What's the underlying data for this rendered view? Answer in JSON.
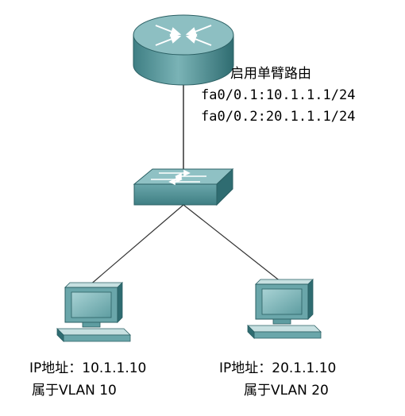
{
  "router": {
    "title": "启用单臂路由",
    "sub1": "fa0/0.1:10.1.1.1/24",
    "sub2": "fa0/0.2:20.1.1.1/24"
  },
  "pc_left": {
    "ip": "IP地址：10.1.1.10",
    "vlan": "属于VLAN 10"
  },
  "pc_right": {
    "ip": "IP地址：20.1.1.10",
    "vlan": "属于VLAN 20"
  },
  "colors": {
    "device_teal": "#4f8f94",
    "device_light": "#8fc1c4",
    "device_dark": "#2d6a70",
    "line": "#333333"
  }
}
